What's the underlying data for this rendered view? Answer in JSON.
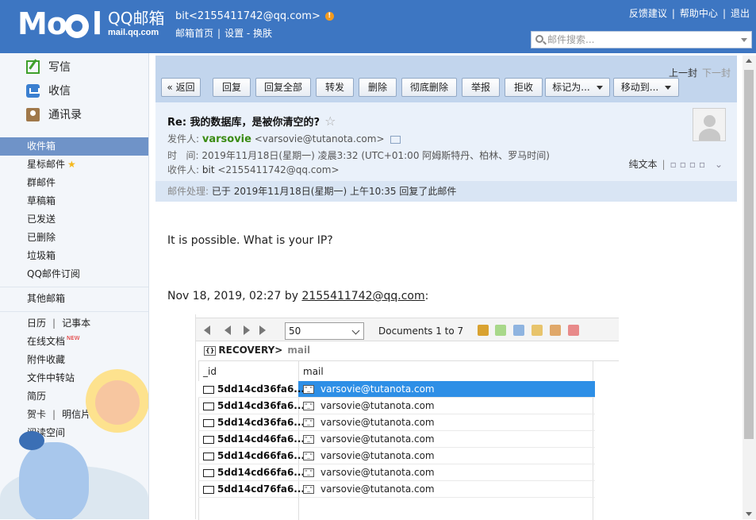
{
  "header": {
    "brand_title": "QQ邮箱",
    "brand_sub": "mail.qq.com",
    "account": "bit<2155411742@qq.com>",
    "account_links": [
      "邮箱首页",
      "设置",
      "换肤"
    ],
    "top_links": [
      "反馈建议",
      "帮助中心",
      "退出"
    ],
    "search_placeholder": "邮件搜索..."
  },
  "sidebar": {
    "actions": [
      "写信",
      "收信",
      "通讯录"
    ],
    "folders": [
      "收件箱",
      "星标邮件",
      "群邮件",
      "草稿箱",
      "已发送",
      "已删除",
      "垃圾箱",
      "QQ邮件订阅"
    ],
    "other_mail": "其他邮箱",
    "apps": {
      "calendar": "日历",
      "notes": "记事本",
      "docs": "在线文档",
      "docs_badge": "NEW",
      "attachments": "附件收藏",
      "transfer": "文件中转站",
      "resume": "简历",
      "cards": "贺卡",
      "postcards": "明信片",
      "reading": "阅读空间"
    }
  },
  "toolbar": {
    "prev": "上一封",
    "next": "下一封",
    "back": "« 返回",
    "reply": "回复",
    "reply_all": "回复全部",
    "forward": "转发",
    "delete": "删除",
    "delete_forever": "彻底删除",
    "report": "举报",
    "reject": "拒收",
    "mark_as": "标记为...",
    "move_to": "移动到..."
  },
  "mail": {
    "subject": "Re: 我的数据库，是被你清空的?",
    "from_label": "发件人:",
    "from_name": "varsovie",
    "from_addr": "<varsovie@tutanota.com>",
    "time_label": "时   间:",
    "time_value": "2019年11月18日(星期一) 凌晨3:32 (UTC+01:00 阿姆斯特丹、柏林、罗马时间)",
    "to_label": "收件人:",
    "to_name": "bit",
    "to_addr": "<2155411742@qq.com>",
    "plain_text": "纯文本",
    "process_label": "邮件处理:",
    "process_value": "已于 2019年11月18日(星期一) 上午10:35 回复了此邮件",
    "body_line1": "It is possible. What is your IP?",
    "quote_prefix": "Nov 18, 2019, 02:27 by ",
    "quote_link": "2155411742@qq.com",
    "quote_suffix": ":"
  },
  "embedded": {
    "page_size": "50",
    "documents": "Documents 1 to 7",
    "db": "RECOVERY",
    "db_arrow": ">",
    "collection": "mail",
    "columns": [
      "_id",
      "mail"
    ],
    "rows": [
      {
        "id": "5dd14cd36fa6...",
        "mail": "varsovie@tutanota.com"
      },
      {
        "id": "5dd14cd36fa6...",
        "mail": "varsovie@tutanota.com"
      },
      {
        "id": "5dd14cd36fa6...",
        "mail": "varsovie@tutanota.com"
      },
      {
        "id": "5dd14cd46fa6...",
        "mail": "varsovie@tutanota.com"
      },
      {
        "id": "5dd14cd66fa6...",
        "mail": "varsovie@tutanota.com"
      },
      {
        "id": "5dd14cd66fa6...",
        "mail": "varsovie@tutanota.com"
      },
      {
        "id": "5dd14cd76fa6...",
        "mail": "varsovie@tutanota.com"
      }
    ]
  },
  "colors": {
    "header_bg": "#3d76c2",
    "mail_top_bg": "#c2d5ed",
    "active_folder": "#6f93c8",
    "sender_green": "#3a8b12",
    "selected_row": "#2e8fe6"
  }
}
